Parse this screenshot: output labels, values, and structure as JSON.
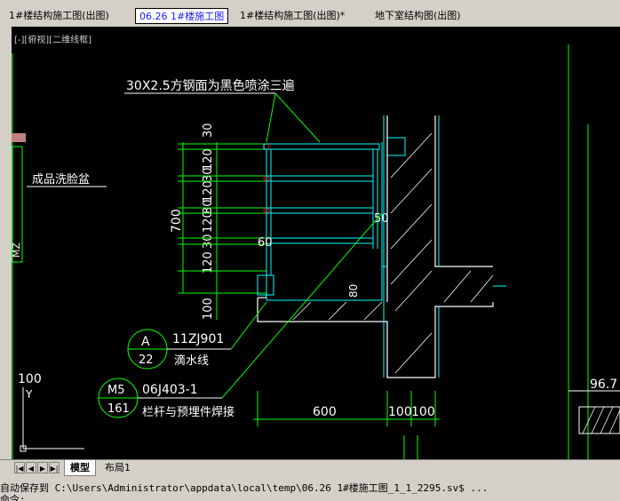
{
  "tabs": [
    {
      "label": "1#楼结构施工图(出图)",
      "active": false
    },
    {
      "label": "06.26 1#楼施工图",
      "active": true
    },
    {
      "label": "1#楼结构施工图(出图)*",
      "active": false
    },
    {
      "label": "地下室结构图(出图)",
      "active": false
    }
  ],
  "viewport": {
    "label": "[-][俯视][二维线框]"
  },
  "drawing": {
    "top_note": "30X2.5方钢面为黑色喷涂三遍",
    "left_label": "成品洗脸盆",
    "left_vertical": "MZ",
    "dim_700": "700",
    "dim_30a": "30",
    "dim_120a": "120",
    "dim_30b": "30",
    "dim_120b": "120",
    "dim_30c": "30",
    "dim_120c": "120",
    "dim_30d": "30",
    "dim_120d": "120",
    "dim_100v": "100",
    "dim_60": "60",
    "dim_50": "50",
    "dim_80": "80",
    "dim_600": "600",
    "dim_100a": "100",
    "dim_100b": "100",
    "ref_a_letter": "A",
    "ref_a_num": "22",
    "ref_a_code": "11ZJ901",
    "ref_a_text": "滴水线",
    "ref_m5_letter": "M5",
    "ref_m5_num": "161",
    "ref_m5_code": "06J403-1",
    "ref_m5_text": "栏杆与预埋件焊接",
    "elev_right": "96.7",
    "coord_y": "100",
    "ucs_y": "Y"
  },
  "layout_tabs": {
    "model": "模型",
    "layout1": "布局1"
  },
  "command": {
    "line1": "自动保存到 C:\\Users\\Administrator\\appdata\\local\\temp\\06.26 1#楼施工图_1_1_2295.sv$ ...",
    "line2": "命令:"
  },
  "colors": {
    "green": "#00ff00",
    "cyan": "#00ffff",
    "white": "#ffffff",
    "red": "#ff0000"
  }
}
